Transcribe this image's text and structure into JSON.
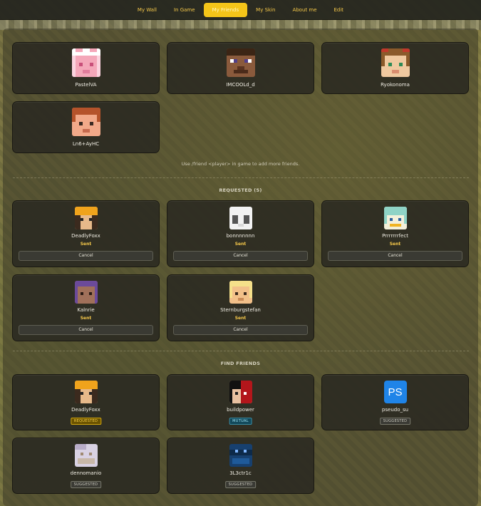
{
  "nav": {
    "items": [
      {
        "label": "My Wall"
      },
      {
        "label": "In Game"
      },
      {
        "label": "My Friends"
      },
      {
        "label": "My Skin"
      },
      {
        "label": "About me"
      },
      {
        "label": "Edit"
      }
    ],
    "active": "My Friends"
  },
  "friends": [
    {
      "name": "PastelVA"
    },
    {
      "name": "IMCOOLd_d"
    },
    {
      "name": "Ryokonoma"
    },
    {
      "name": "Ln6+AyHC"
    }
  ],
  "hint": "Use /friend <player> in game to add more friends.",
  "requested": {
    "title": "REQUESTED (5)",
    "status_label": "Sent",
    "cancel_label": "Cancel",
    "items": [
      {
        "name": "DeadlyFoxx"
      },
      {
        "name": "bonnnnnnn"
      },
      {
        "name": "Prrrrrrrfect"
      },
      {
        "name": "Kalnrie"
      },
      {
        "name": "Sternburgstefan"
      }
    ]
  },
  "find": {
    "title": "FIND FRIENDS",
    "items": [
      {
        "name": "DeadlyFoxx",
        "badge": "REQUESTED"
      },
      {
        "name": "buildpower",
        "badge": "MUTUAL"
      },
      {
        "name": "pseudo_su",
        "badge": "SUGGESTED",
        "logo_text": "PS"
      },
      {
        "name": "dennomanio",
        "badge": "SUGGESTED"
      },
      {
        "name": "3L3ctr1c",
        "badge": "SUGGESTED"
      }
    ]
  },
  "colors": {
    "accent": "#f5c519",
    "nav_text": "#f5c84a",
    "card_bg": "#2a2921",
    "requested_badge": "#d3a70f",
    "mutual_badge": "#3a8aa0"
  }
}
